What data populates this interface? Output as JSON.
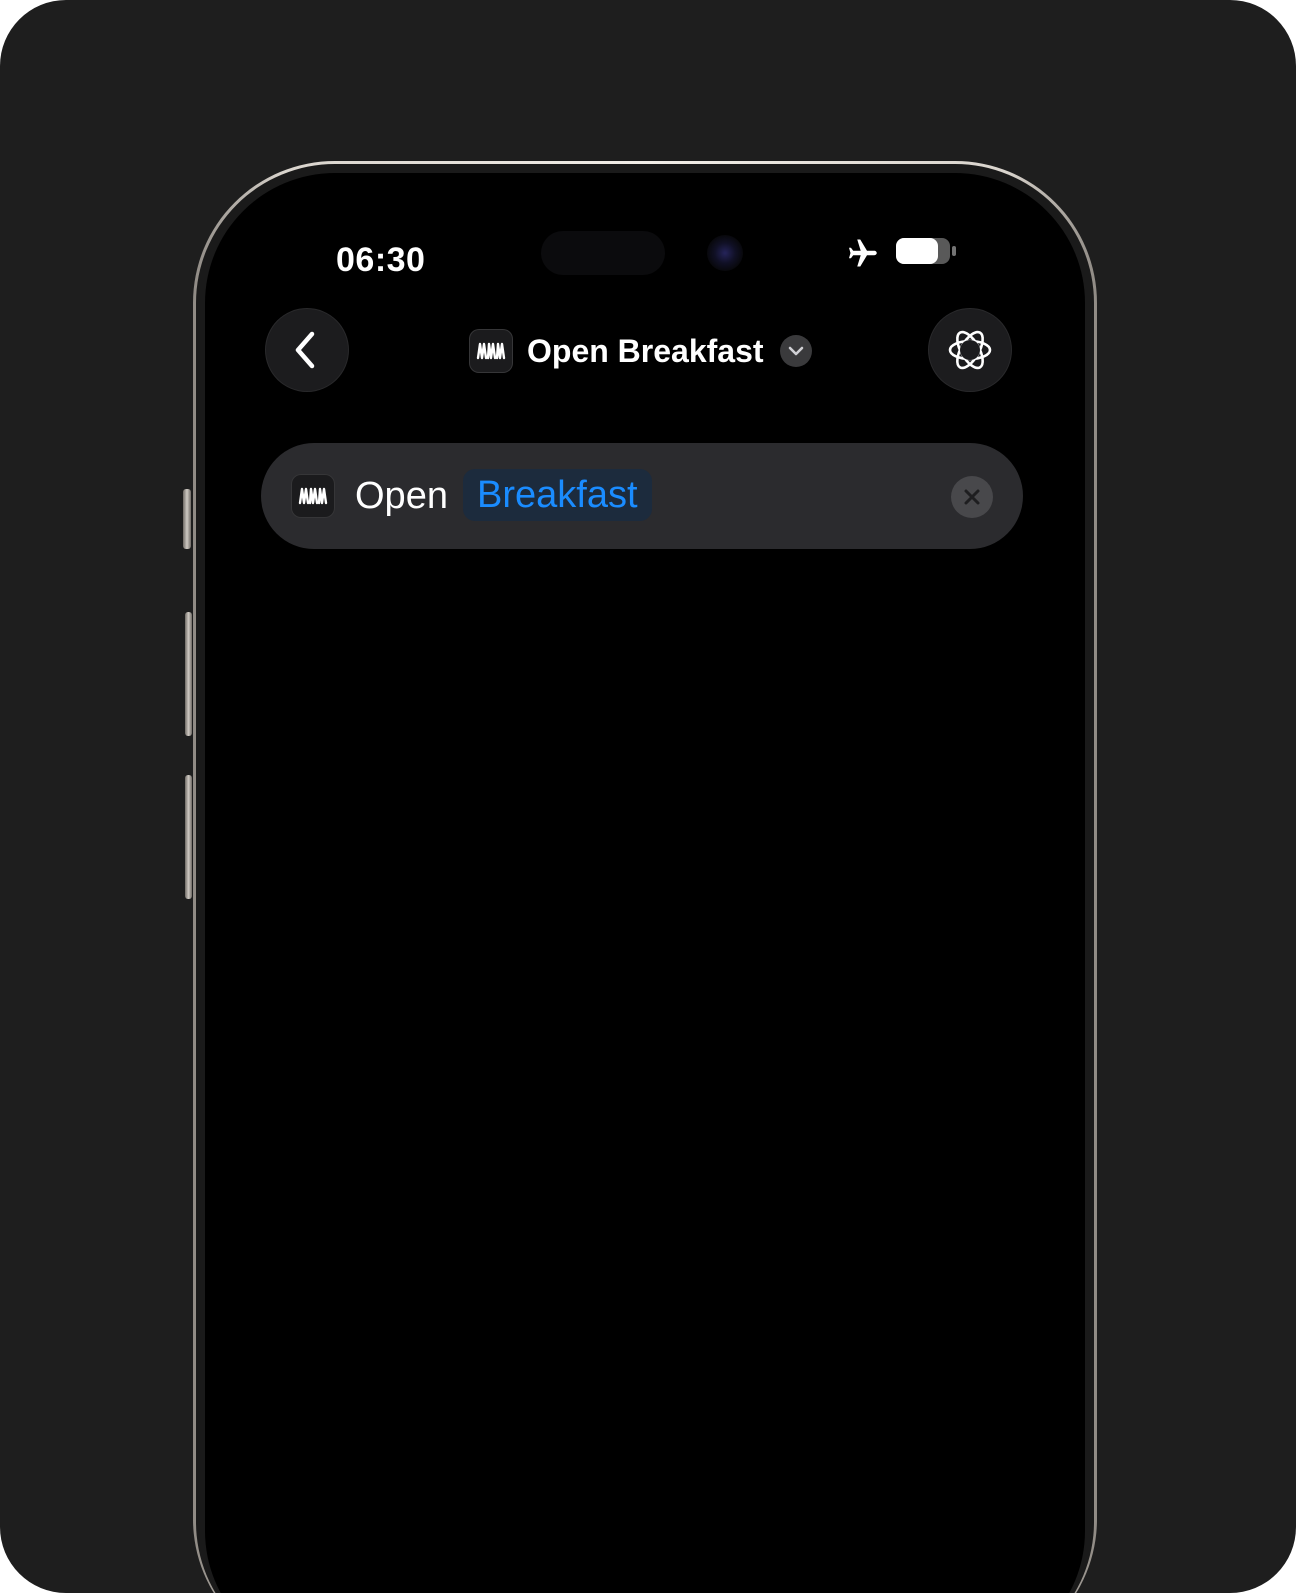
{
  "status_bar": {
    "time": "06:30",
    "icons": [
      "airplane-icon",
      "battery-icon"
    ]
  },
  "nav": {
    "back_icon": "chevron-left-icon",
    "title": "Open Breakfast",
    "app_icon": "breakfast-app-icon",
    "menu_icon": "chevron-down-icon",
    "assistant_icon": "apple-intelligence-icon"
  },
  "action": {
    "verb": "Open",
    "parameter": "Breakfast",
    "app_icon": "breakfast-app-icon",
    "clear_icon": "close-icon"
  },
  "colors": {
    "background": "#1e1e1e",
    "screen": "#000000",
    "action_bg": "#2b2b2e",
    "accent": "#1a8cff"
  }
}
